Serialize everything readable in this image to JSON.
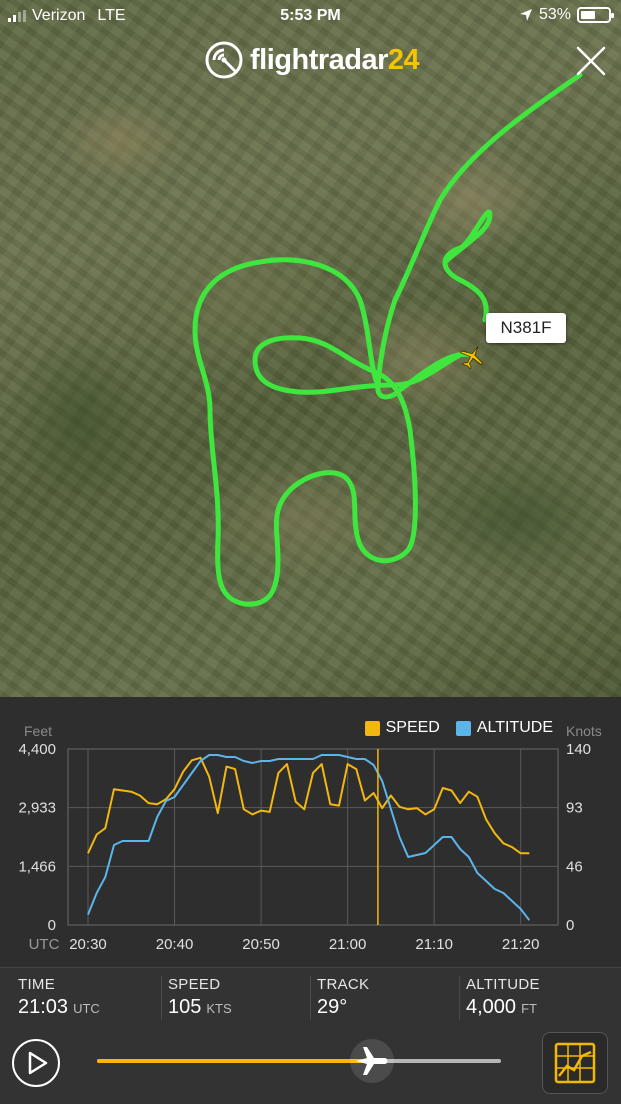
{
  "status_bar": {
    "carrier": "Verizon",
    "network": "LTE",
    "time": "5:53 PM",
    "battery": "53%",
    "battery_level": 0.53
  },
  "app": {
    "logo_main": "flightradar",
    "logo_num": "24"
  },
  "map": {
    "callsign": "N381F",
    "track_color": "#3ee63e",
    "aircraft_color": "#f5c400"
  },
  "legend": {
    "speed": "SPEED",
    "altitude": "ALTITUDE"
  },
  "colors": {
    "speed": "#f2b711",
    "altitude": "#5bb4ea",
    "accent": "#f5b800"
  },
  "chart_data": {
    "type": "line",
    "left_axis_label": "Feet",
    "right_axis_label": "Knots",
    "left_ticks": [
      "4,400",
      "2,933",
      "1,466",
      "0"
    ],
    "right_ticks": [
      "140",
      "93",
      "46",
      "0"
    ],
    "x_prefix": "UTC",
    "x_ticks": [
      "20:30",
      "20:40",
      "20:50",
      "21:00",
      "21:10",
      "21:20"
    ],
    "xlim_minutes": [
      0,
      52
    ],
    "ylim_feet": [
      0,
      4400
    ],
    "ylim_knots": [
      0,
      140
    ],
    "cursor_minute": 33.5,
    "grid": true,
    "legend_position": "top-right",
    "series": [
      {
        "name": "SPEED",
        "axis": "right",
        "x": [
          0,
          1,
          2,
          3,
          4,
          5,
          6,
          7,
          8,
          9,
          10,
          11,
          12,
          13,
          14,
          15,
          16,
          17,
          18,
          19,
          20,
          21,
          22,
          23,
          24,
          25,
          26,
          27,
          28,
          29,
          30,
          31,
          32,
          33,
          34,
          35,
          36,
          37,
          38,
          39,
          40,
          41,
          42,
          43,
          44,
          45,
          46,
          47,
          48,
          49,
          50,
          51
        ],
        "values": [
          57,
          72,
          77,
          108,
          107,
          106,
          103,
          97,
          96,
          100,
          108,
          122,
          131,
          133,
          118,
          89,
          126,
          124,
          92,
          88,
          91,
          90,
          121,
          128,
          98,
          92,
          121,
          128,
          96,
          95,
          128,
          124,
          99,
          105,
          93,
          103,
          94,
          92,
          93,
          88,
          92,
          109,
          107,
          97,
          106,
          102,
          84,
          73,
          65,
          62,
          57,
          57
        ]
      },
      {
        "name": "ALTITUDE",
        "axis": "left",
        "x": [
          0,
          1,
          2,
          3,
          4,
          5,
          6,
          7,
          8,
          9,
          10,
          11,
          12,
          13,
          14,
          15,
          16,
          17,
          18,
          19,
          20,
          21,
          22,
          23,
          24,
          25,
          26,
          27,
          28,
          29,
          30,
          31,
          32,
          33,
          34,
          35,
          36,
          37,
          38,
          39,
          40,
          41,
          42,
          43,
          44,
          45,
          46,
          47,
          48,
          49,
          50,
          51
        ],
        "values": [
          260,
          800,
          1200,
          2000,
          2100,
          2100,
          2100,
          2100,
          2700,
          3100,
          3200,
          3500,
          3800,
          4100,
          4250,
          4250,
          4200,
          4200,
          4100,
          4050,
          4100,
          4100,
          4150,
          4150,
          4150,
          4150,
          4150,
          4250,
          4250,
          4250,
          4200,
          4150,
          4150,
          4000,
          3600,
          2900,
          2200,
          1700,
          1750,
          1800,
          2000,
          2200,
          2200,
          1900,
          1700,
          1300,
          1100,
          900,
          800,
          600,
          400,
          120
        ]
      }
    ]
  },
  "info": {
    "time_label": "TIME",
    "time_value": "21:03",
    "time_unit": "UTC",
    "speed_label": "SPEED",
    "speed_value": "105",
    "speed_unit": "KTS",
    "track_label": "TRACK",
    "track_value": "29°",
    "altitude_label": "ALTITUDE",
    "altitude_value": "4,000",
    "altitude_unit": "FT"
  },
  "playback": {
    "progress": 0.68
  }
}
